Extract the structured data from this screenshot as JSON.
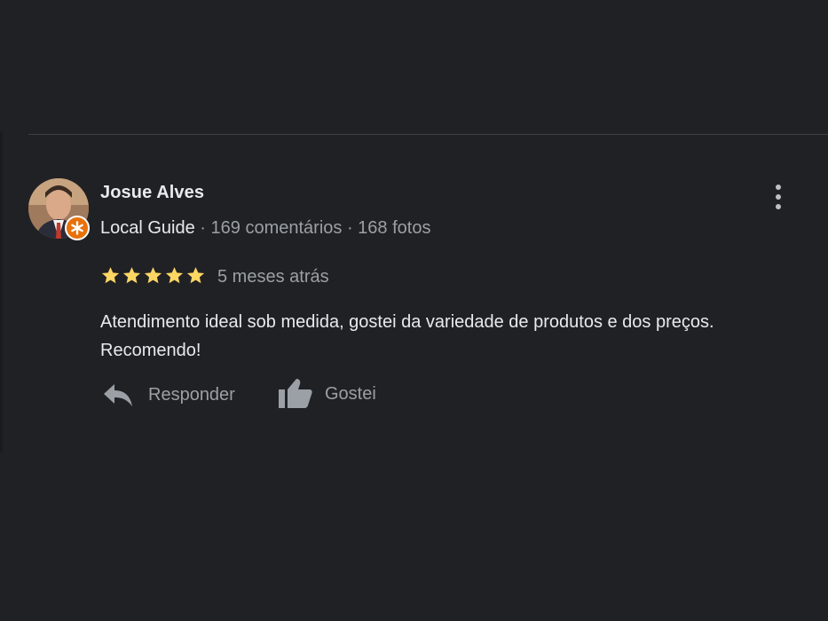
{
  "review": {
    "reviewer_name": "Josue Alves",
    "guide_label": "Local Guide",
    "stats": " · 169 comentários · 168 fotos",
    "rating": 5,
    "rating_max": 5,
    "date": "5 meses atrás",
    "text": "Atendimento ideal sob medida, gostei da variedade de produtos e dos preços. Recomendo!",
    "actions": {
      "reply_label": "Responder",
      "like_label": "Gostei"
    }
  },
  "colors": {
    "background": "#202124",
    "primary_text": "#e8eaed",
    "secondary_text": "#9aa0a6",
    "star": "#fdd663",
    "badge": "#e8710a"
  },
  "icons": {
    "menu": "more-vert-icon",
    "reply": "reply-icon",
    "like": "thumb-up-icon",
    "badge": "local-guide-badge-icon",
    "star": "star-icon"
  }
}
